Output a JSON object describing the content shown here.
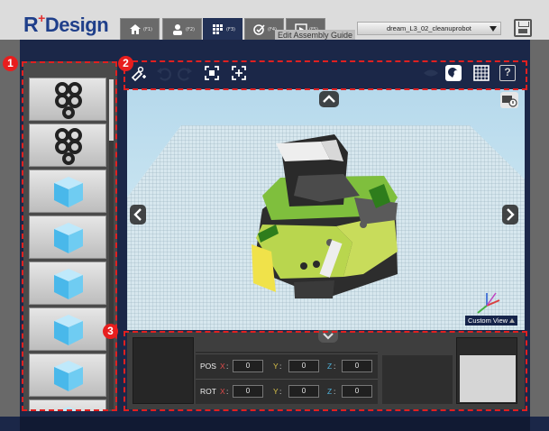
{
  "app": {
    "logo_prefix": "R",
    "logo_plus": "+",
    "logo_suffix": "Design"
  },
  "tabs": [
    {
      "id": "home",
      "num": "(F1)",
      "icon": "home-icon",
      "active": false
    },
    {
      "id": "assembly",
      "num": "(F2)",
      "icon": "person-icon",
      "active": false
    },
    {
      "id": "edit-assembly-guide",
      "num": "(F3)",
      "icon": "grid-icon",
      "active": true
    },
    {
      "id": "check",
      "num": "(F4)",
      "icon": "check-gear-icon",
      "active": false
    },
    {
      "id": "play",
      "num": "(F5)",
      "icon": "play-icon",
      "active": false
    }
  ],
  "tooltip": "Edit Assembly Guide",
  "file": {
    "name": "dream_L3_02_cleanuprobot"
  },
  "toolbar": {
    "left_tools": [
      "add-part-icon",
      "undo-icon",
      "redo-icon",
      "zoom-fit-icon",
      "focus-icon"
    ],
    "right_tools": [
      "eye-icon",
      "magnet-icon",
      "grid-toggle-icon",
      "help-icon"
    ],
    "help_label": "?"
  },
  "parts_list": [
    "connector-cross-part",
    "connector-cross-part",
    "cube-part",
    "cube-part",
    "cube-part",
    "cube-part",
    "cube-part",
    "cube-part"
  ],
  "viewport": {
    "view_label": "Custom View"
  },
  "coords": {
    "pos": {
      "label": "POS",
      "x": "0",
      "y": "0",
      "z": "0"
    },
    "rot": {
      "label": "ROT",
      "x": "0",
      "y": "0",
      "z": "0"
    },
    "axis_x": "X",
    "axis_y": "Y",
    "axis_z": "Z",
    "colon": ":"
  },
  "annotations": [
    {
      "number": "1"
    },
    {
      "number": "2"
    },
    {
      "number": "3"
    }
  ],
  "colors": {
    "accent": "#e02020",
    "navy": "#1b2748",
    "sky": "#b6d9ec"
  }
}
